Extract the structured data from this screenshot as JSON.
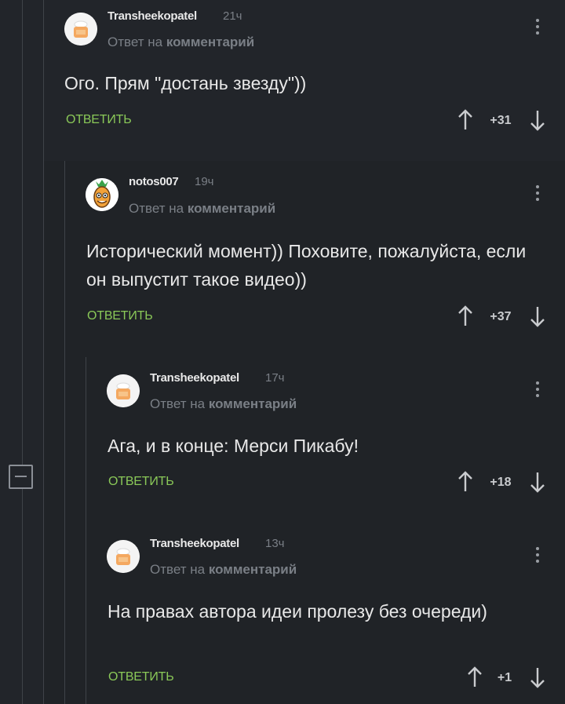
{
  "comments": [
    {
      "author": "Transheekopatel",
      "time": "21ч",
      "reply_prefix": "Ответ на",
      "reply_target": "комментарий",
      "text": "Ого. Прям \"достань звезду\"))",
      "reply_label": "ОТВЕТИТЬ",
      "rating": "+31",
      "avatar": "chef-avatar"
    },
    {
      "author": "notos007",
      "time": "19ч",
      "reply_prefix": "Ответ на",
      "reply_target": "комментарий",
      "text": "Исторический момент)) Поховите, пожалуйста, если он выпустит такое видео))",
      "reply_label": "ОТВЕТИТЬ",
      "rating": "+37",
      "avatar": "pineapple-avatar"
    },
    {
      "author": "Transheekopatel",
      "time": "17ч",
      "reply_prefix": "Ответ на",
      "reply_target": "комментарий",
      "text": "Ага, и в конце: Мерси Пикабу!",
      "reply_label": "ОТВЕТИТЬ",
      "rating": "+18",
      "avatar": "chef-avatar"
    },
    {
      "author": "Transheekopatel",
      "time": "13ч",
      "reply_prefix": "Ответ на",
      "reply_target": "комментарий",
      "text": "На правах автора идеи пролезу без очереди)",
      "reply_label": "ОТВЕТИТЬ",
      "rating": "+1",
      "avatar": "chef-avatar"
    }
  ],
  "colors": {
    "background": "#22252a",
    "reply_green": "#8ac858",
    "muted_text": "#7a7f86",
    "thread_line": "#3f4349"
  },
  "icons": [
    "collapse-thread-icon",
    "more-options-icon",
    "upvote-arrow-icon",
    "downvote-arrow-icon"
  ]
}
